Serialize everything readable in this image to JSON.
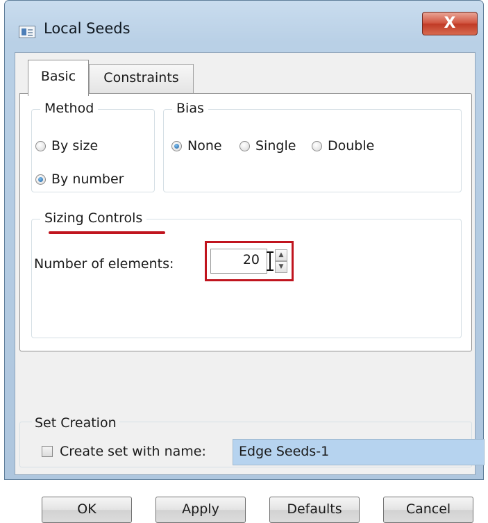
{
  "window": {
    "title": "Local Seeds",
    "close_glyph": "X",
    "icon": "window-app-icon"
  },
  "tabs": [
    {
      "label": "Basic",
      "active": true
    },
    {
      "label": "Constraints",
      "active": false
    }
  ],
  "method": {
    "legend": "Method",
    "options": [
      {
        "label": "By size",
        "checked": false
      },
      {
        "label": "By number",
        "checked": true
      }
    ]
  },
  "bias": {
    "legend": "Bias",
    "options": [
      {
        "label": "None",
        "checked": true
      },
      {
        "label": "Single",
        "checked": false
      },
      {
        "label": "Double",
        "checked": false
      }
    ]
  },
  "sizing": {
    "legend": "Sizing Controls",
    "number_label": "Number of elements:",
    "number_value": "20",
    "spin_up": "▲",
    "spin_down": "▼"
  },
  "set_creation": {
    "legend": "Set Creation",
    "checkbox_label": "Create set with name:",
    "checked": false,
    "name_value": "Edge Seeds-1"
  },
  "buttons": {
    "ok": "OK",
    "apply": "Apply",
    "defaults": "Defaults",
    "cancel": "Cancel"
  },
  "colors": {
    "highlight": "#c0141e",
    "close_button": "#c94a34",
    "selected_field": "#b6d3ef"
  }
}
